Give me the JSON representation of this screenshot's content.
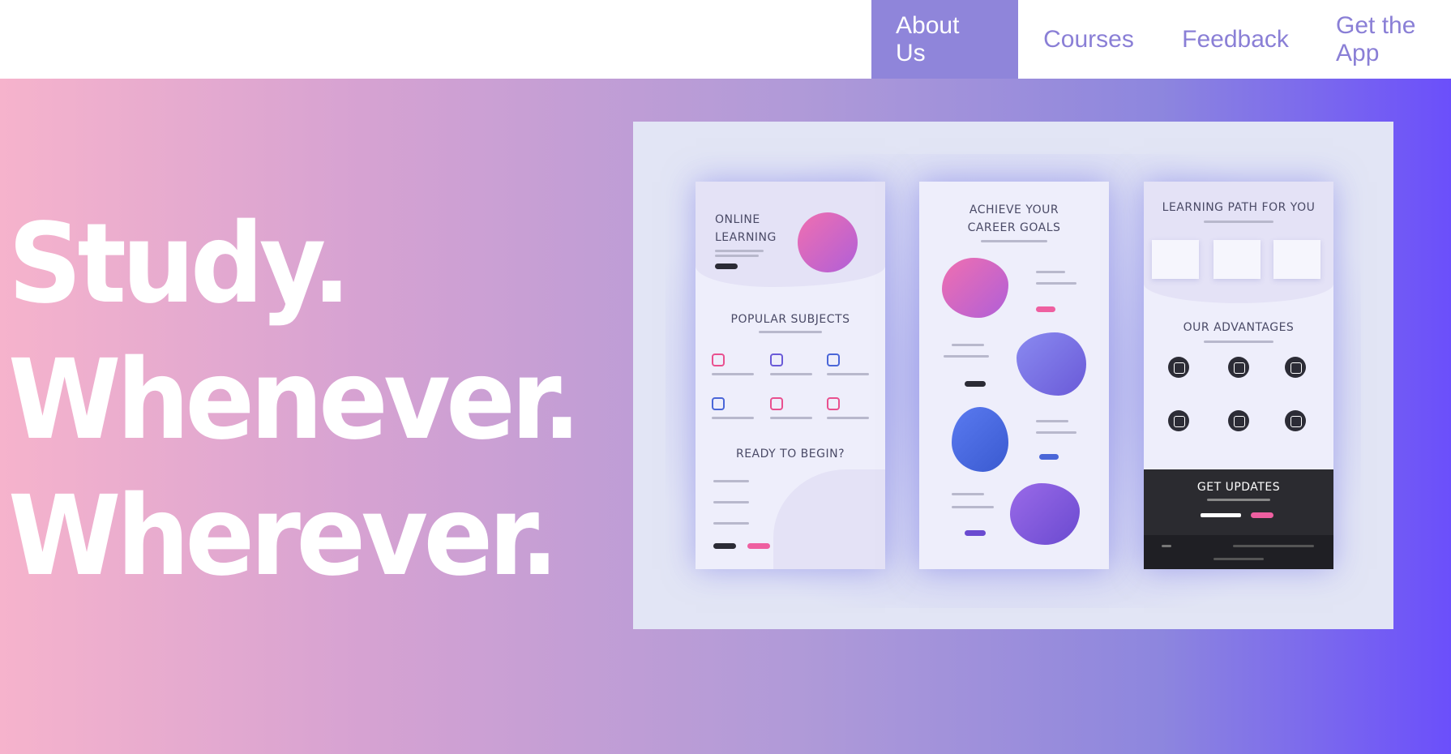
{
  "nav": {
    "items": [
      {
        "label": "About Us",
        "active": true
      },
      {
        "label": "Courses",
        "active": false
      },
      {
        "label": "Feedback",
        "active": false
      },
      {
        "label": "Get the App",
        "active": false
      }
    ]
  },
  "hero": {
    "lines": [
      "Study.",
      "Whenever.",
      "Wherever."
    ]
  },
  "mockup": {
    "panel1": {
      "title_line1": "ONLINE",
      "title_line2": "LEARNING",
      "section1": "POPULAR SUBJECTS",
      "section2": "READY TO BEGIN?"
    },
    "panel2": {
      "title_line1": "ACHIEVE YOUR",
      "title_line2": "CAREER GOALS"
    },
    "panel3": {
      "title": "LEARNING PATH FOR YOU",
      "section1": "OUR ADVANTAGES",
      "section2": "GET UPDATES"
    }
  },
  "colors": {
    "nav_active_bg": "#8f85da",
    "nav_text": "#8a7fd6",
    "gradient_start": "#f6b3cc",
    "gradient_end": "#6b4ffb"
  }
}
